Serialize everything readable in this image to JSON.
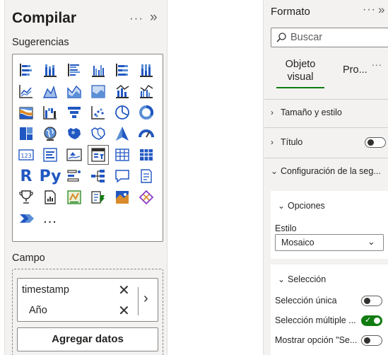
{
  "build_pane": {
    "title": "Compilar",
    "more_icon": "ellipsis-icon",
    "collapse_icon": "double-chevron-right-icon",
    "suggestions_label": "Sugerencias",
    "visual_icons": [
      "stacked-bar-chart-icon",
      "stacked-column-chart-icon",
      "clustered-bar-chart-icon",
      "clustered-column-chart-icon",
      "100-stacked-bar-chart-icon",
      "100-stacked-column-chart-icon",
      "line-chart-icon",
      "area-chart-icon",
      "stacked-area-chart-icon",
      "100-stacked-area-chart-icon",
      "line-and-stacked-column-chart-icon",
      "line-and-clustered-column-chart-icon",
      "ribbon-chart-icon",
      "waterfall-chart-icon",
      "funnel-chart-icon",
      "scatter-chart-icon",
      "pie-chart-icon",
      "donut-chart-icon",
      "treemap-icon",
      "map-icon",
      "filled-map-icon",
      "shape-map-icon",
      "azure-map-icon",
      "gauge-icon",
      "card-icon",
      "multi-row-card-icon",
      "kpi-icon",
      "slicer-icon",
      "table-icon",
      "matrix-icon",
      "r-visual-icon",
      "python-visual-icon",
      "key-influencers-icon",
      "decomposition-tree-icon",
      "qa-icon",
      "smart-narrative-icon",
      "metrics-icon",
      "paginated-report-icon",
      "power-apps-icon",
      "power-automate-icon",
      "arcgis-icon",
      "diamond-icon",
      "power-automate-flow-icon",
      "more-visuals-icon"
    ],
    "r_label": "R",
    "py_label": "Py",
    "more_visuals_label": "...",
    "field_label": "Campo",
    "fields": [
      {
        "name": "timestamp",
        "remove_icon": "close-icon"
      },
      {
        "name": "Año",
        "remove_icon": "close-icon"
      }
    ],
    "expand_icon": "chevron-right-icon",
    "add_data_label": "Agregar datos"
  },
  "format_pane": {
    "title": "Formato",
    "more_icon": "ellipsis-icon",
    "collapse_icon": "double-chevron-right-icon",
    "search_placeholder": "Buscar",
    "tabs": {
      "visual_line1": "Objeto",
      "visual_line2": "visual",
      "properties": "Pro...",
      "more": "..."
    },
    "sections": {
      "size_style": "Tamaño y estilo",
      "title": "Título",
      "title_toggle_on": false,
      "slicer_settings": "Configuración de la seg..."
    },
    "options_card": {
      "title": "Opciones",
      "style_label": "Estilo",
      "style_value": "Mosaico"
    },
    "selection_card": {
      "title": "Selección",
      "single_label": "Selección única",
      "single_on": false,
      "multi_label": "Selección múltiple ...",
      "multi_on": true,
      "show_all_label": "Mostrar opción \"Se...",
      "show_all_on": false
    },
    "colors": {
      "accent": "#107c10",
      "pane_bg": "#f3f2f1",
      "visual_blue": "#2157c1"
    }
  }
}
